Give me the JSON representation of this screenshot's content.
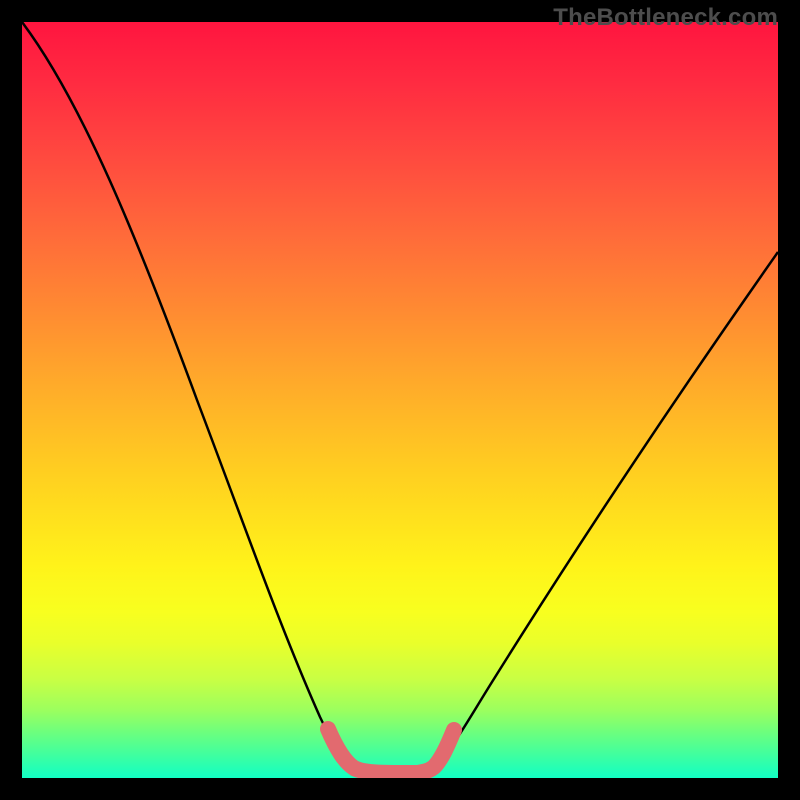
{
  "watermark": "TheBottleneck.com",
  "chart_data": {
    "type": "line",
    "title": "",
    "xlabel": "",
    "ylabel": "",
    "xlim": [
      0,
      100
    ],
    "ylim": [
      0,
      100
    ],
    "grid": false,
    "series": [
      {
        "name": "bottleneck-curve",
        "x": [
          0,
          5,
          10,
          15,
          20,
          25,
          30,
          35,
          39,
          41,
          44,
          47,
          50,
          53,
          55,
          60,
          65,
          70,
          75,
          80,
          85,
          90,
          95,
          100
        ],
        "values": [
          100,
          90,
          80,
          70,
          60,
          50,
          40,
          29,
          16,
          8,
          2,
          1,
          1,
          2,
          8,
          16,
          23,
          30,
          37,
          44,
          51,
          58,
          64,
          70
        ]
      }
    ],
    "highlight": {
      "name": "optimal-range",
      "x": [
        40.5,
        42,
        44,
        47,
        50,
        53,
        54.5
      ],
      "values": [
        6.5,
        3,
        1,
        0.5,
        0.5,
        1,
        6.5
      ],
      "color": "#e26a6f"
    },
    "gradient_stops": [
      {
        "pos": 0,
        "color": "#ff153f"
      },
      {
        "pos": 50,
        "color": "#ffc024"
      },
      {
        "pos": 78,
        "color": "#f8ff1f"
      },
      {
        "pos": 100,
        "color": "#12ffc4"
      }
    ]
  }
}
